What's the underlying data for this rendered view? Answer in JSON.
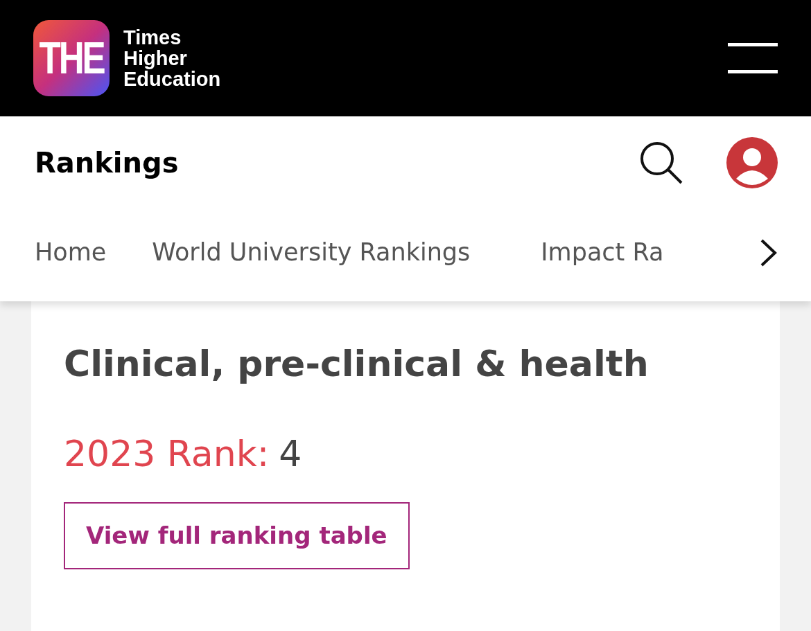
{
  "logo": {
    "mark": "THE",
    "name_lines": [
      "Times",
      "Higher",
      "Education"
    ]
  },
  "section_title": "Rankings",
  "nav_tabs": [
    {
      "label": "Home"
    },
    {
      "label": "World University Rankings"
    },
    {
      "label": "Impact Ra"
    }
  ],
  "card": {
    "title": "Clinical, pre-clinical & health",
    "rank_label": "2023 Rank:",
    "rank_value": "4",
    "button": "View full ranking table"
  }
}
